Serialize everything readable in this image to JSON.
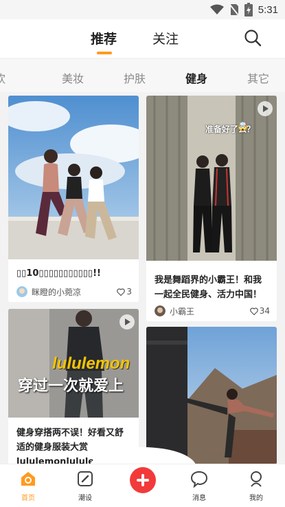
{
  "status_bar": {
    "time": "5:31"
  },
  "header": {
    "tabs": [
      {
        "label": "推荐",
        "active": true
      },
      {
        "label": "关注",
        "active": false
      }
    ]
  },
  "categories": {
    "partial_left": "饮",
    "items": [
      "美妆",
      "护肤",
      "健身",
      "其它"
    ],
    "active": "健身"
  },
  "feed": {
    "cards": [
      {
        "title": "▯▯10▯▯▯▯▯▯▯▯▯▯▯!!",
        "user": "眯瞪的小菀凉",
        "likes": "3",
        "video": false
      },
      {
        "title": "我是舞蹈界的小霸王！和我一起全民健身、活力中国！",
        "user": "小霸王",
        "likes": "34",
        "video": true,
        "overlay_text": "准备好了么？",
        "overlay_emoji": "🤯"
      },
      {
        "title": "健身穿搭两不误！好看又舒适的健身服装大赏lululemonlululemon全",
        "video": true,
        "overlay_brand": "lululemon",
        "overlay_slogan": "穿过一次就爱上"
      },
      {
        "video": false
      }
    ]
  },
  "bottom_nav": {
    "items": [
      {
        "label": "首页",
        "icon": "home-icon",
        "active": true
      },
      {
        "label": "潮设",
        "icon": "edit-icon",
        "active": false
      },
      {
        "label": "",
        "icon": "add-icon",
        "active": false
      },
      {
        "label": "消息",
        "icon": "message-icon",
        "active": false
      },
      {
        "label": "我的",
        "icon": "profile-icon",
        "active": false
      }
    ]
  },
  "colors": {
    "accent": "#ff9a1f",
    "add_button": "#f23a3a"
  }
}
